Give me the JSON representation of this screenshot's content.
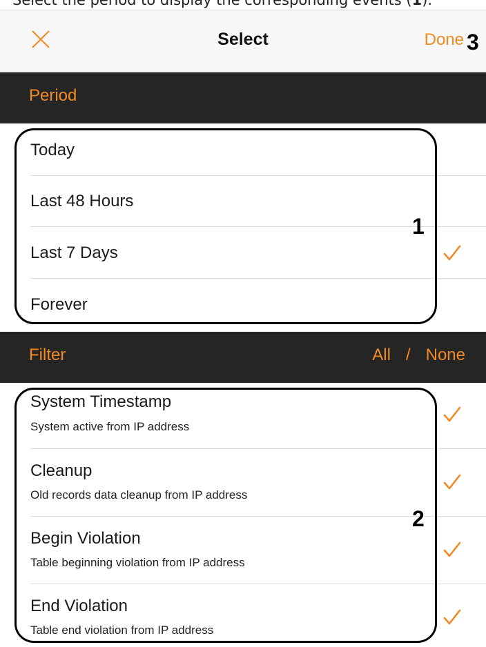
{
  "caption": {
    "text": "Select the period to display the corresponding events (",
    "bold": "1",
    "end": ")."
  },
  "navbar": {
    "close_icon": "close-icon",
    "title": "Select",
    "done_label": "Done"
  },
  "callouts": {
    "one": "1",
    "two": "2",
    "three": "3"
  },
  "period": {
    "header": "Period",
    "items": [
      {
        "label": "Today",
        "selected": false
      },
      {
        "label": "Last 48 Hours",
        "selected": false
      },
      {
        "label": "Last 7 Days",
        "selected": true
      },
      {
        "label": "Forever",
        "selected": false
      }
    ]
  },
  "filter": {
    "header": "Filter",
    "all_label": "All",
    "separator": "/",
    "none_label": "None",
    "items": [
      {
        "label": "System Timestamp",
        "sublabel": "System active from IP address",
        "checked": true
      },
      {
        "label": "Cleanup",
        "sublabel": "Old records data cleanup from IP address",
        "checked": true
      },
      {
        "label": "Begin Violation",
        "sublabel": "Table beginning violation from IP address",
        "checked": true
      },
      {
        "label": "End Violation",
        "sublabel": "Table end violation from IP address",
        "checked": true
      }
    ]
  },
  "colors": {
    "accent": "#f28a22",
    "header_bg": "#252525",
    "navbar_bg": "#f7f7f7"
  }
}
